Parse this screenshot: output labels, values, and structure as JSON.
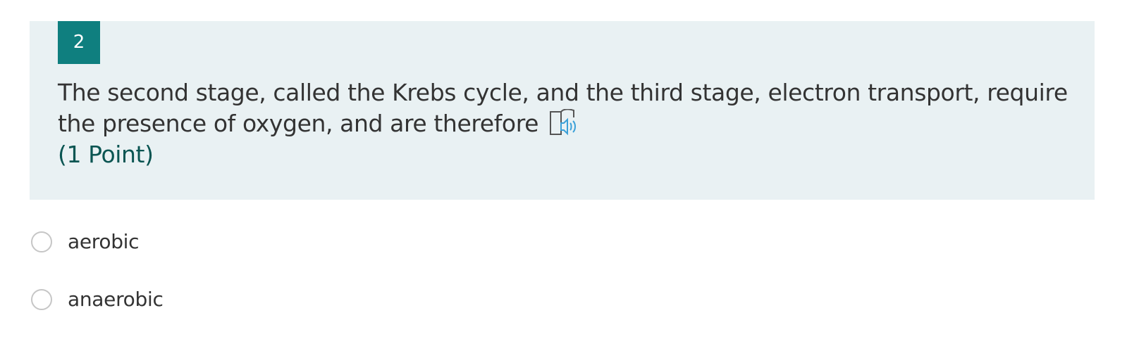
{
  "question": {
    "number": "2",
    "text": "The second stage, called the Krebs cycle, and the third stage, electron transport, require the presence of oxygen, and are therefore",
    "points": "(1 Point)",
    "reader_icon": "immersive-reader-icon"
  },
  "choices": [
    {
      "label": "aerobic",
      "selected": false
    },
    {
      "label": "anaerobic",
      "selected": false
    }
  ],
  "colors": {
    "accent": "#0f7f7f",
    "card_background": "#e9f1f3",
    "points_text": "#0a5552",
    "reader_icon_blue": "#3aa0d8"
  }
}
